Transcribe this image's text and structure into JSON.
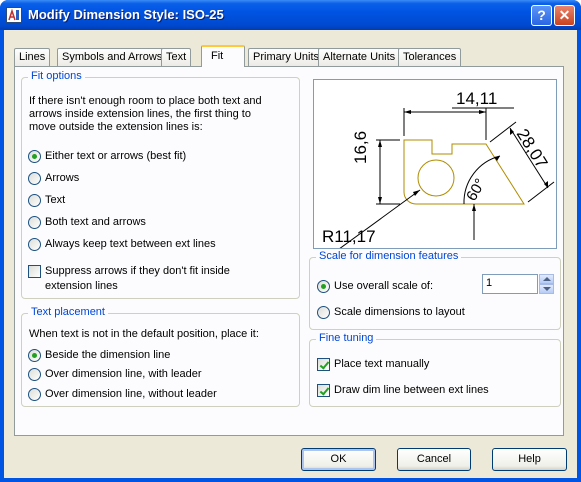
{
  "window": {
    "title": "Modify Dimension Style: ISO-25",
    "help_symbol": "?",
    "close_symbol": "✕"
  },
  "tabs": [
    {
      "label": "Lines"
    },
    {
      "label": "Symbols and Arrows"
    },
    {
      "label": "Text"
    },
    {
      "label": "Fit",
      "active": true
    },
    {
      "label": "Primary Units"
    },
    {
      "label": "Alternate Units"
    },
    {
      "label": "Tolerances"
    }
  ],
  "fit_options": {
    "legend": "Fit options",
    "description": [
      "If there isn't enough room to place both text and",
      "arrows inside extension lines, the first thing to",
      "move outside the extension lines is:"
    ],
    "options": [
      {
        "label": "Either text or arrows (best fit)",
        "selected": true
      },
      {
        "label": "Arrows",
        "selected": false
      },
      {
        "label": "Text",
        "selected": false
      },
      {
        "label": "Both text and arrows",
        "selected": false
      },
      {
        "label": "Always keep text between ext lines",
        "selected": false
      }
    ],
    "suppress": {
      "label_line1": "Suppress arrows if they don't fit inside",
      "label_line2": "extension lines",
      "checked": false
    }
  },
  "text_placement": {
    "legend": "Text placement",
    "description": "When text is not in the default position, place it:",
    "options": [
      {
        "label": "Beside the dimension line",
        "selected": true
      },
      {
        "label": "Over dimension line, with leader",
        "selected": false
      },
      {
        "label": "Over dimension line, without leader",
        "selected": false
      }
    ]
  },
  "preview": {
    "dim_top": "14,11",
    "dim_left": "16,6",
    "dim_right": "28,07",
    "dim_angle": "60°",
    "dim_radius": "R11,17"
  },
  "scale": {
    "legend": "Scale for dimension features",
    "use_overall_label": "Use overall scale of:",
    "use_overall_selected": true,
    "scale_value": "1",
    "to_layout_label": "Scale dimensions to layout",
    "to_layout_selected": false
  },
  "fine_tuning": {
    "legend": "Fine tuning",
    "place_manual_label": "Place text manually",
    "place_manual_checked": true,
    "draw_dim_label": "Draw dim line between ext lines",
    "draw_dim_checked": true
  },
  "buttons": {
    "ok": "OK",
    "cancel": "Cancel",
    "help": "Help"
  },
  "colors": {
    "title_bar": "#0054e3",
    "dialog_bg": "#ece9d8",
    "group_legend": "#0046d5",
    "drawing_shape": "#b08d00"
  }
}
